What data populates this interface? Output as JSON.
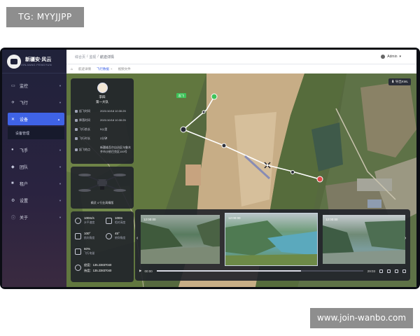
{
  "watermarks": {
    "top_left": "TG: MYYJJPP",
    "bottom_right": "www.join-wanbo.com"
  },
  "brand": {
    "title": "新疆安·风云",
    "subtitle": "XINJIANG FENGYUN"
  },
  "sidebar": {
    "items": [
      {
        "label": "监控",
        "icon": "monitor-icon"
      },
      {
        "label": "飞行",
        "icon": "plane-icon"
      },
      {
        "label": "设备",
        "icon": "device-icon",
        "active": true
      },
      {
        "label": "设备管理",
        "icon": "",
        "sub": true
      },
      {
        "label": "飞手",
        "icon": "user-icon"
      },
      {
        "label": "团队",
        "icon": "team-icon"
      },
      {
        "label": "租户",
        "icon": "tenant-icon"
      },
      {
        "label": "设置",
        "icon": "gear-icon"
      },
      {
        "label": "关于",
        "icon": "info-icon"
      }
    ]
  },
  "header": {
    "breadcrumb": [
      "综合页",
      "监视",
      "航迹详情"
    ],
    "user": "Admin"
  },
  "tabs": {
    "home_icon": "home-icon",
    "items": [
      "航迹详情",
      "飞行数据",
      "视频文件"
    ],
    "active_index": 1
  },
  "map": {
    "export_label": "导出KML",
    "waypoint_label": "起飞"
  },
  "pilot": {
    "name": "李四",
    "team": "第一大队",
    "rows": [
      {
        "key": "起飞时间",
        "value": "2021/10/18 10:30:25"
      },
      {
        "key": "降落时间",
        "value": "2021/10/18 10:30:25"
      },
      {
        "key": "飞行航长",
        "value": "5公里"
      },
      {
        "key": "飞行时长",
        "value": "2分钟"
      },
      {
        "key": "起飞地点",
        "value": "新疆维吾尔自治区乌鲁木齐市沙依巴克区100号"
      }
    ]
  },
  "drone": {
    "name": "精灵 4 行业高精版"
  },
  "stats": [
    {
      "value": "100m/s",
      "label": "水平速度"
    },
    {
      "value": "100m",
      "label": "相对高度"
    },
    {
      "value": "100°",
      "label": "航向角度"
    },
    {
      "value": "45°",
      "label": "俯仰角度"
    },
    {
      "value": "60%",
      "label": "飞行电量"
    },
    {
      "value": "经度：135.23837040",
      "label": ""
    },
    {
      "value": "纬度：135.23837040",
      "label": ""
    }
  ],
  "video": {
    "thumbs": [
      {
        "time": "12:00:00"
      },
      {
        "time": "12:00:00"
      },
      {
        "time": "12:00:00"
      }
    ],
    "current": "00:00",
    "total": "29:03",
    "progress": 0.7
  },
  "colors": {
    "accent": "#3f63e6",
    "track": "#ffffff",
    "start": "#3fc35a",
    "end": "#e04848"
  }
}
